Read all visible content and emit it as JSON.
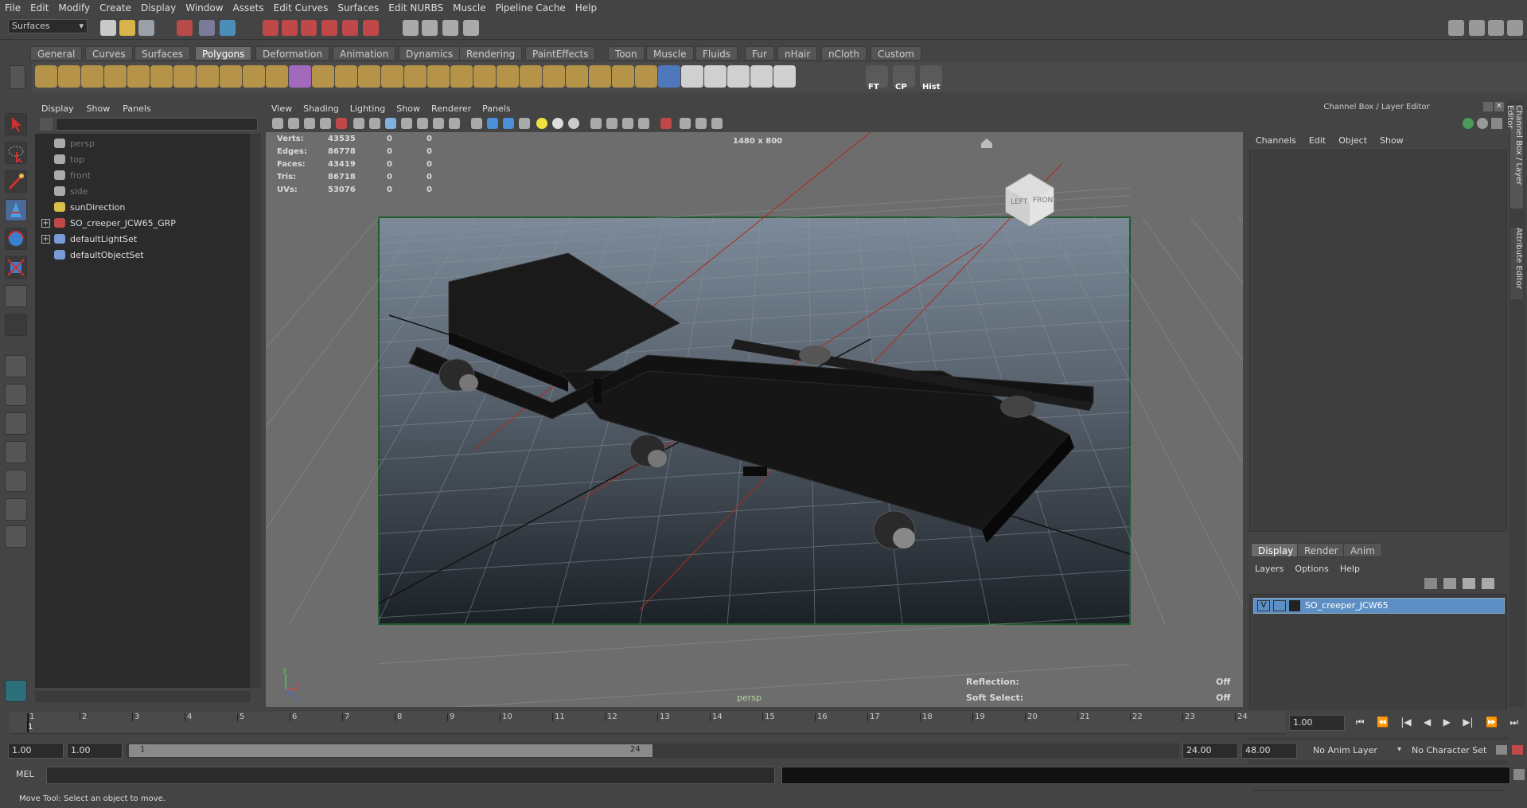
{
  "menubar": [
    "File",
    "Edit",
    "Modify",
    "Create",
    "Display",
    "Window",
    "Assets",
    "Edit Curves",
    "Surfaces",
    "Edit NURBS",
    "Muscle",
    "Pipeline Cache",
    "Help"
  ],
  "status": {
    "mode_menu": "Surfaces"
  },
  "shelf": {
    "tabs": [
      "General",
      "Curves",
      "Surfaces",
      "Polygons",
      "Deformation",
      "Animation",
      "Dynamics",
      "Rendering",
      "PaintEffects",
      "Toon",
      "Muscle",
      "Fluids",
      "Fur",
      "nHair",
      "nCloth",
      "Custom"
    ],
    "active_tab": "Polygons",
    "labels": [
      "FT",
      "CP",
      "Hist"
    ]
  },
  "outliner": {
    "menu": [
      "Display",
      "Show",
      "Panels"
    ],
    "items": [
      {
        "label": "persp",
        "dim": true,
        "icon": "camera-icon"
      },
      {
        "label": "top",
        "dim": true,
        "icon": "camera-icon"
      },
      {
        "label": "front",
        "dim": true,
        "icon": "camera-icon"
      },
      {
        "label": "side",
        "dim": true,
        "icon": "camera-icon"
      },
      {
        "label": "sunDirection",
        "dim": false,
        "icon": "light-icon"
      },
      {
        "label": "SO_creeper_JCW65_GRP",
        "dim": false,
        "icon": "group-icon",
        "expandable": true
      },
      {
        "label": "defaultLightSet",
        "dim": false,
        "icon": "set-icon",
        "expandable": true
      },
      {
        "label": "defaultObjectSet",
        "dim": false,
        "icon": "set-icon"
      }
    ]
  },
  "viewport": {
    "menu": [
      "View",
      "Shading",
      "Lighting",
      "Show",
      "Renderer",
      "Panels"
    ],
    "resolution": "1480 x 800",
    "camera": "persp",
    "stats": [
      {
        "label": "Verts:",
        "v1": "43535",
        "v2": "0",
        "v3": "0"
      },
      {
        "label": "Edges:",
        "v1": "86778",
        "v2": "0",
        "v3": "0"
      },
      {
        "label": "Faces:",
        "v1": "43419",
        "v2": "0",
        "v3": "0"
      },
      {
        "label": "Tris:",
        "v1": "86718",
        "v2": "0",
        "v3": "0"
      },
      {
        "label": "UVs:",
        "v1": "53076",
        "v2": "0",
        "v3": "0"
      }
    ],
    "reflection_label": "Reflection:",
    "reflection_value": "Off",
    "softselect_label": "Soft Select:",
    "softselect_value": "Off",
    "viewcube_left": "LEFT",
    "viewcube_front": "FRONT",
    "axis_y": "y",
    "axis_x": "x",
    "axis_z": "z"
  },
  "channelbox": {
    "title": "Channel Box / Layer Editor",
    "menu": [
      "Channels",
      "Edit",
      "Object",
      "Show"
    ],
    "side_tabs": [
      "Channel Box / Layer Editor",
      "Attribute Editor"
    ],
    "layer_tabs": [
      "Display",
      "Render",
      "Anim"
    ],
    "layer_menu": [
      "Layers",
      "Options",
      "Help"
    ],
    "layer": {
      "visible": "V",
      "name": "SO_creeper_JCW65"
    }
  },
  "timeline": {
    "ticks": [
      "1",
      "2",
      "3",
      "4",
      "5",
      "6",
      "7",
      "8",
      "9",
      "10",
      "11",
      "12",
      "13",
      "14",
      "15",
      "16",
      "17",
      "18",
      "19",
      "20",
      "21",
      "22",
      "23",
      "24"
    ],
    "current_frame_label": "1",
    "current_time": "1.00"
  },
  "range": {
    "start": "1.00",
    "anim_start": "1.00",
    "slider_start": "1",
    "slider_end": "24",
    "anim_end": "24.00",
    "end": "48.00",
    "anim_layer": "No Anim Layer",
    "char_set": "No Character Set"
  },
  "command": {
    "label": "MEL"
  },
  "help": {
    "text": "Move Tool: Select an object to move."
  },
  "colors": {
    "layer_highlight": "#5e8fc4",
    "shelf_active": "#6b6b6b"
  }
}
